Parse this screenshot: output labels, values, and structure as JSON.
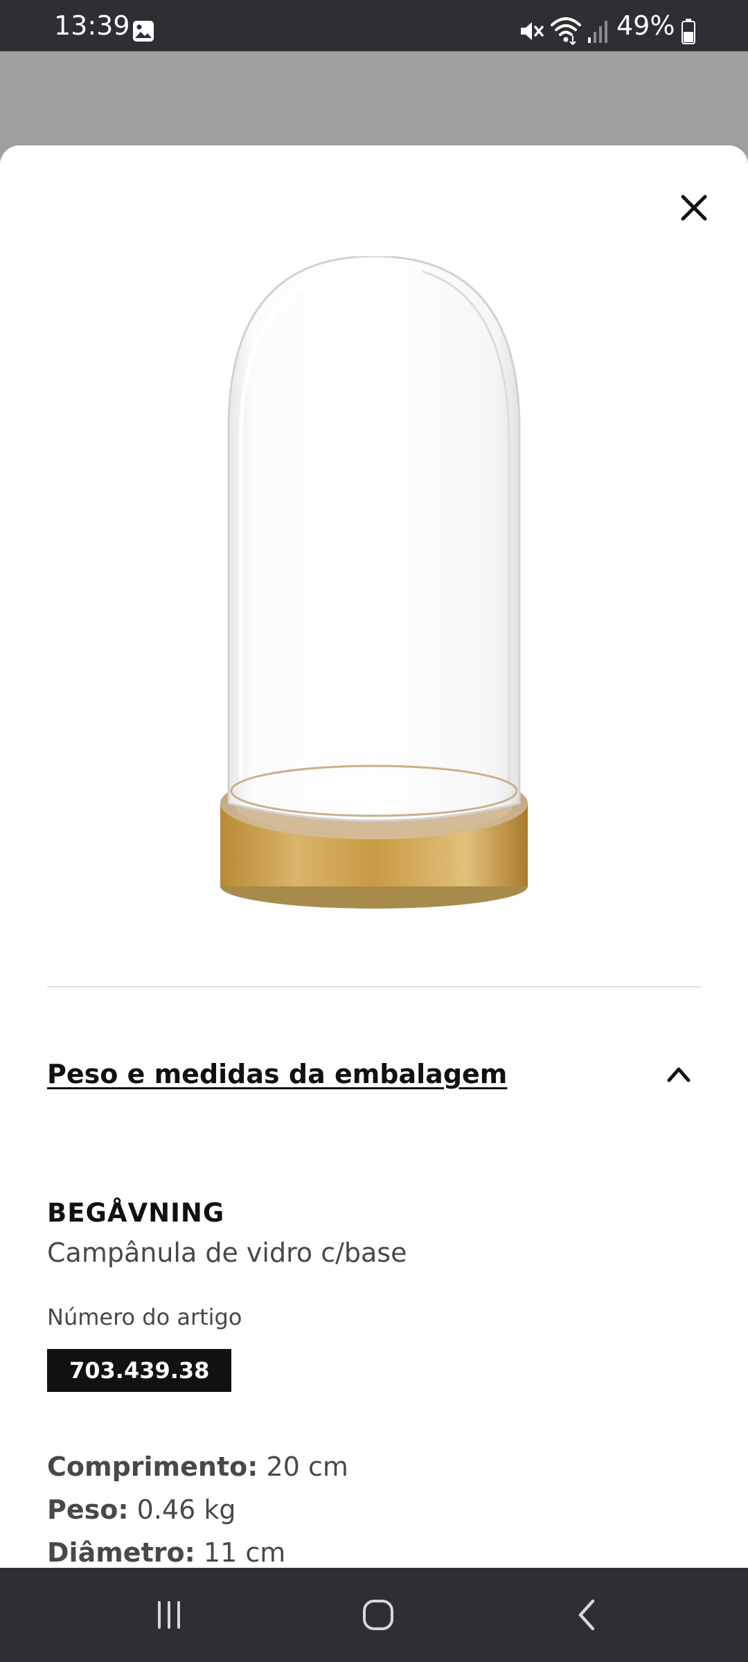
{
  "status_bar": {
    "time": "13:39",
    "battery": "49%",
    "icons": [
      "gallery-icon",
      "mute-icon",
      "wifi-icon",
      "signal-icon",
      "battery-icon"
    ]
  },
  "sheet": {
    "close_icon": "close-icon",
    "accordion": {
      "title": "Peso e medidas da embalagem",
      "expanded": true,
      "icon": "chevron-up-icon"
    },
    "product": {
      "name": "BEGÅVNING",
      "description": "Campânula de vidro c/base",
      "article_label": "Número do artigo",
      "article_number": "703.439.38"
    },
    "specs": [
      {
        "label": "Comprimento:",
        "value": "20 cm"
      },
      {
        "label": "Peso:",
        "value": "0.46 kg"
      },
      {
        "label": "Diâmetro:",
        "value": "11 cm"
      }
    ]
  },
  "nav_bar": {
    "icons": [
      "recents-icon",
      "home-icon",
      "back-icon"
    ]
  },
  "colors": {
    "status_bar": "#2e2e33",
    "backdrop": "#9f9f9f",
    "sheet": "#ffffff",
    "article_badge": "#111111",
    "gold": "#c9a44a"
  }
}
